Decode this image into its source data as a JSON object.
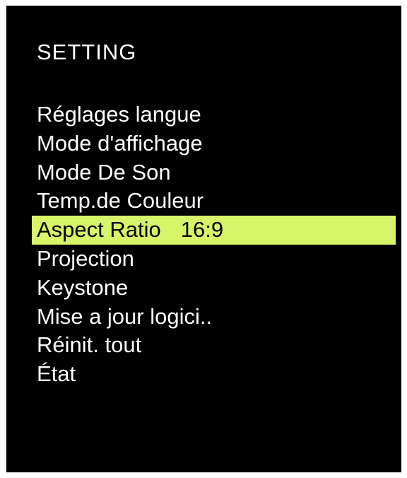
{
  "header": {
    "title": "SETTING"
  },
  "menu": {
    "items": [
      {
        "label": "Réglages langue",
        "value": ""
      },
      {
        "label": "Mode d'affichage",
        "value": ""
      },
      {
        "label": "Mode De Son",
        "value": ""
      },
      {
        "label": "Temp.de Couleur",
        "value": ""
      },
      {
        "label": "Aspect Ratio",
        "value": "16:9"
      },
      {
        "label": "Projection",
        "value": ""
      },
      {
        "label": "Keystone",
        "value": ""
      },
      {
        "label": "Mise a jour logici..",
        "value": ""
      },
      {
        "label": "Réinit. tout",
        "value": ""
      },
      {
        "label": "État",
        "value": ""
      }
    ],
    "selected_index": 4
  },
  "colors": {
    "background": "#000000",
    "text": "#ffffff",
    "highlight": "#d8f56a",
    "highlight_text": "#000000"
  }
}
